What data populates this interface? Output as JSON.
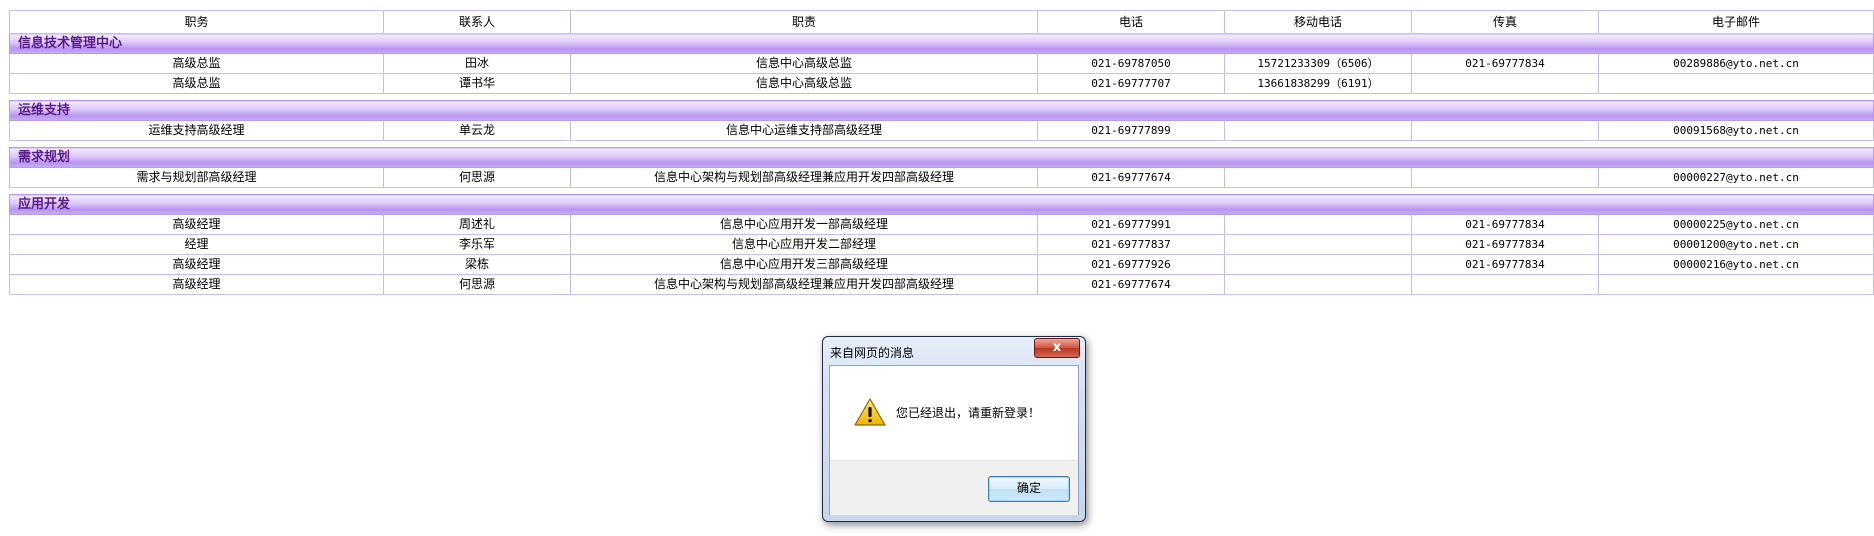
{
  "table": {
    "headers": [
      "职务",
      "联系人",
      "职责",
      "电话",
      "移动电话",
      "传真",
      "电子邮件"
    ],
    "groups": [
      {
        "name": "信息技术管理中心",
        "rows": [
          [
            "高级总监",
            "田冰",
            "信息中心高级总监",
            "021-69787050",
            "15721233309（6506）",
            "021-69777834",
            "00289886@yto.net.cn"
          ],
          [
            "高级总监",
            "谭书华",
            "信息中心高级总监",
            "021-69777707",
            "13661838299（6191）",
            "",
            ""
          ]
        ]
      },
      {
        "name": "运维支持",
        "rows": [
          [
            "运维支持高级经理",
            "单云龙",
            "信息中心运维支持部高级经理",
            "021-69777899",
            "",
            "",
            "00091568@yto.net.cn"
          ]
        ]
      },
      {
        "name": "需求规划",
        "rows": [
          [
            "需求与规划部高级经理",
            "何思源",
            "信息中心架构与规划部高级经理兼应用开发四部高级经理",
            "021-69777674",
            "",
            "",
            "00000227@yto.net.cn"
          ]
        ]
      },
      {
        "name": "应用开发",
        "rows": [
          [
            "高级经理",
            "周述礼",
            "信息中心应用开发一部高级经理",
            "021-69777991",
            "",
            "021-69777834",
            "00000225@yto.net.cn"
          ],
          [
            "经理",
            "李乐军",
            "信息中心应用开发二部经理",
            "021-69777837",
            "",
            "021-69777834",
            "00001200@yto.net.cn"
          ],
          [
            "高级经理",
            "梁栋",
            "信息中心应用开发三部高级经理",
            "021-69777926",
            "",
            "021-69777834",
            "00000216@yto.net.cn"
          ],
          [
            "高级经理",
            "何思源",
            "信息中心架构与规划部高级经理兼应用开发四部高级经理",
            "021-69777674",
            "",
            "",
            ""
          ]
        ]
      }
    ]
  },
  "dialog": {
    "title": "来自网页的消息",
    "close_label": "x",
    "message": "您已经退出，请重新登录！",
    "ok_label": "确定",
    "icon": "warning-icon"
  },
  "colors": {
    "group_text": "#5a1a8a",
    "group_band": "#c9aef5",
    "table_border": "#c6c0e6"
  }
}
